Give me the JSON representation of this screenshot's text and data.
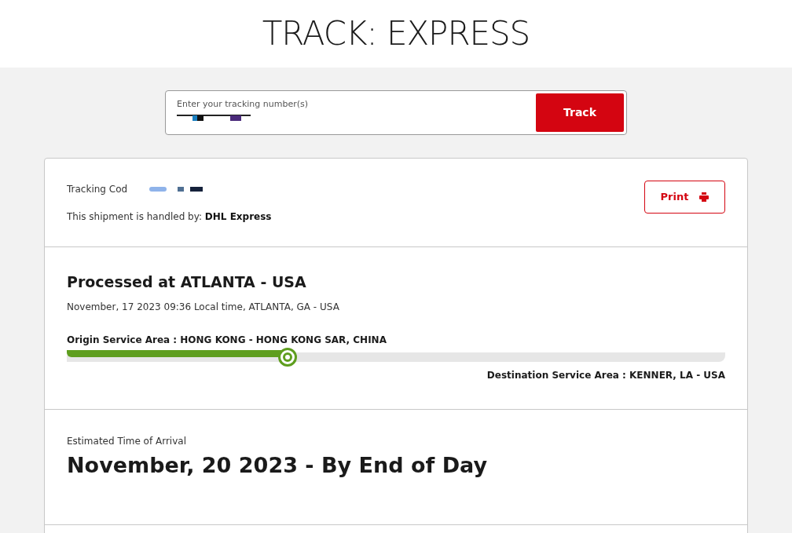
{
  "page_title": "TRACK: EXPRESS",
  "search": {
    "label": "Enter your tracking number(s)",
    "button": "Track"
  },
  "summary": {
    "tracking_label": "Tracking Cod",
    "handled_by_label": "This shipment is handled by:",
    "handled_by": "DHL Express",
    "print_button": "Print"
  },
  "status": {
    "title": "Processed at ATLANTA - USA",
    "timestamp": "November, 17 2023 09:36 Local time, ATLANTA, GA - USA",
    "origin": "Origin Service Area : HONG KONG - HONG KONG SAR, CHINA",
    "destination": "Destination Service Area : KENNER, LA - USA",
    "progress": {
      "level": 0.335
    }
  },
  "eta": {
    "label": "Estimated Time of Arrival",
    "value": "November, 20 2023 - By End of Day"
  }
}
